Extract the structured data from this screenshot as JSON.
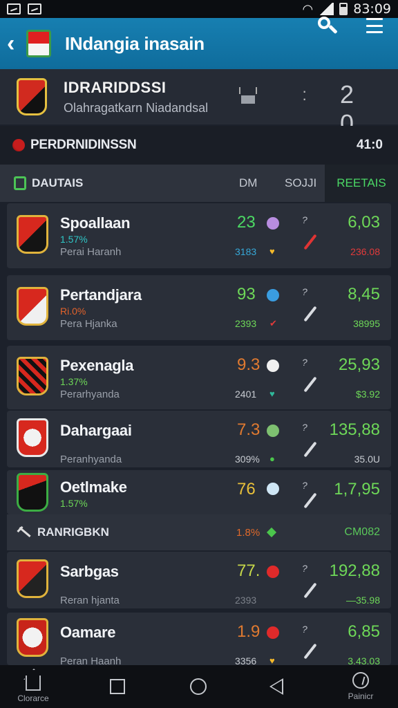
{
  "status_bar": {
    "time": "83:09"
  },
  "app_bar": {
    "title": "INdangia inasain"
  },
  "team_header": {
    "name": "IDRARIDDSSI",
    "subtitle": "Olahragatkarn Niadandsal",
    "score": "2 0"
  },
  "competition": {
    "name": "PERDRNIDINSSN",
    "time": "41:0"
  },
  "tabs": {
    "label": "DAUTAIS",
    "col_dm": "DM",
    "col_sort": "SOJJI",
    "active": "REETAIS"
  },
  "matches": [
    {
      "name": "Spoallaan",
      "pct": "1.57%",
      "sub": "Perai Haranh",
      "score": "23",
      "score_color": "#4cd964",
      "circle_color": "#b88de0",
      "small": "3183",
      "small_color": "#36a8d8",
      "heart": "♥",
      "heart_color": "#f5b92a",
      "q": "?",
      "odds": "6,03",
      "oddsub": "236.08",
      "oddsub_color": "#e23a3a",
      "pct_color": "#2fc6c6"
    },
    {
      "name": "Pertandjara",
      "pct": "Ri.0%",
      "sub": "Pera Hjanka",
      "score": "93",
      "score_color": "#6ed858",
      "circle_color": "#3a9de0",
      "small": "2393",
      "small_color": "#6ed858",
      "heart": "✔",
      "heart_color": "#e23a3a",
      "q": "?",
      "odds": "8,45",
      "oddsub": "38995",
      "oddsub_color": "#6ed858",
      "pct_color": "#e2622b"
    },
    {
      "name": "Pexenagla",
      "pct": "1.37%",
      "sub": "Perarhyanda",
      "score": "9.3",
      "score_color": "#e07a30",
      "circle_color": "#f0f0f0",
      "small": "2401",
      "small_color": "#c8ccd2",
      "heart": "♥",
      "heart_color": "#2fb89a",
      "q": "?",
      "odds": "25,93",
      "oddsub": "$3.92",
      "oddsub_color": "#6ed858",
      "pct_color": "#6ed858"
    },
    {
      "name": "Dahargaai",
      "pct": "",
      "sub": "Peranhyanda",
      "score": "7.3",
      "score_color": "#e07a30",
      "circle_color": "#7ec070",
      "small": "309%",
      "small_color": "#c8ccd2",
      "heart": "●",
      "heart_color": "#4bc64c",
      "q": "?",
      "odds": "135,88",
      "oddsub": "35.0U",
      "oddsub_color": "#c8ccd2",
      "pct_color": "#6ed858"
    },
    {
      "name": "Oetlmake",
      "pct": "1.57%",
      "sub": "",
      "score": "76",
      "score_color": "#e8c03a",
      "circle_color": "#cfe6f5",
      "small": "",
      "small_color": "#c8ccd2",
      "heart": "",
      "heart_color": "#c8ccd2",
      "q": "?",
      "odds": "1,7,95",
      "oddsub": "",
      "oddsub_color": "#6ed858",
      "pct_color": "#6ed858"
    },
    {
      "name": "Sarbgas",
      "pct": "",
      "sub": "Reran hjanta",
      "score": "77.",
      "score_color": "#c7d84a",
      "circle_color": "#e02a2a",
      "small": "2393",
      "small_color": "#7c818a",
      "heart": "",
      "heart_color": "#c8ccd2",
      "q": "?",
      "odds": "192,88",
      "oddsub": "—35.98",
      "oddsub_color": "#6ed858",
      "pct_color": "#6ed858"
    },
    {
      "name": "Oamare",
      "pct": "",
      "sub": "Peran Haanh",
      "score": "1.9",
      "score_color": "#e07a30",
      "circle_color": "#e02a2a",
      "small": "3356",
      "small_color": "#c8ccd2",
      "heart": "♥",
      "heart_color": "#f5b92a",
      "q": "?",
      "odds": "6,85",
      "oddsub": "3.43.03",
      "oddsub_color": "#6ed858",
      "pct_color": "#6ed858"
    }
  ],
  "ranking_row": {
    "label": "RANRIGBKN",
    "pct": "1.8%",
    "value": "CM082"
  },
  "nav": {
    "home_label": "Clorarce",
    "profile_label": "Painicr"
  },
  "icons": [
    "back-icon",
    "app-logo-icon",
    "search-icon",
    "menu-icon",
    "team-crest-icon",
    "sort-icon",
    "more-dots-icon",
    "competition-dot-icon",
    "tab-icon",
    "circle-icon",
    "slash-icon",
    "ranking-icon",
    "home-icon",
    "square-icon",
    "circle-nav-icon",
    "back-triangle-icon",
    "ball-icon"
  ]
}
